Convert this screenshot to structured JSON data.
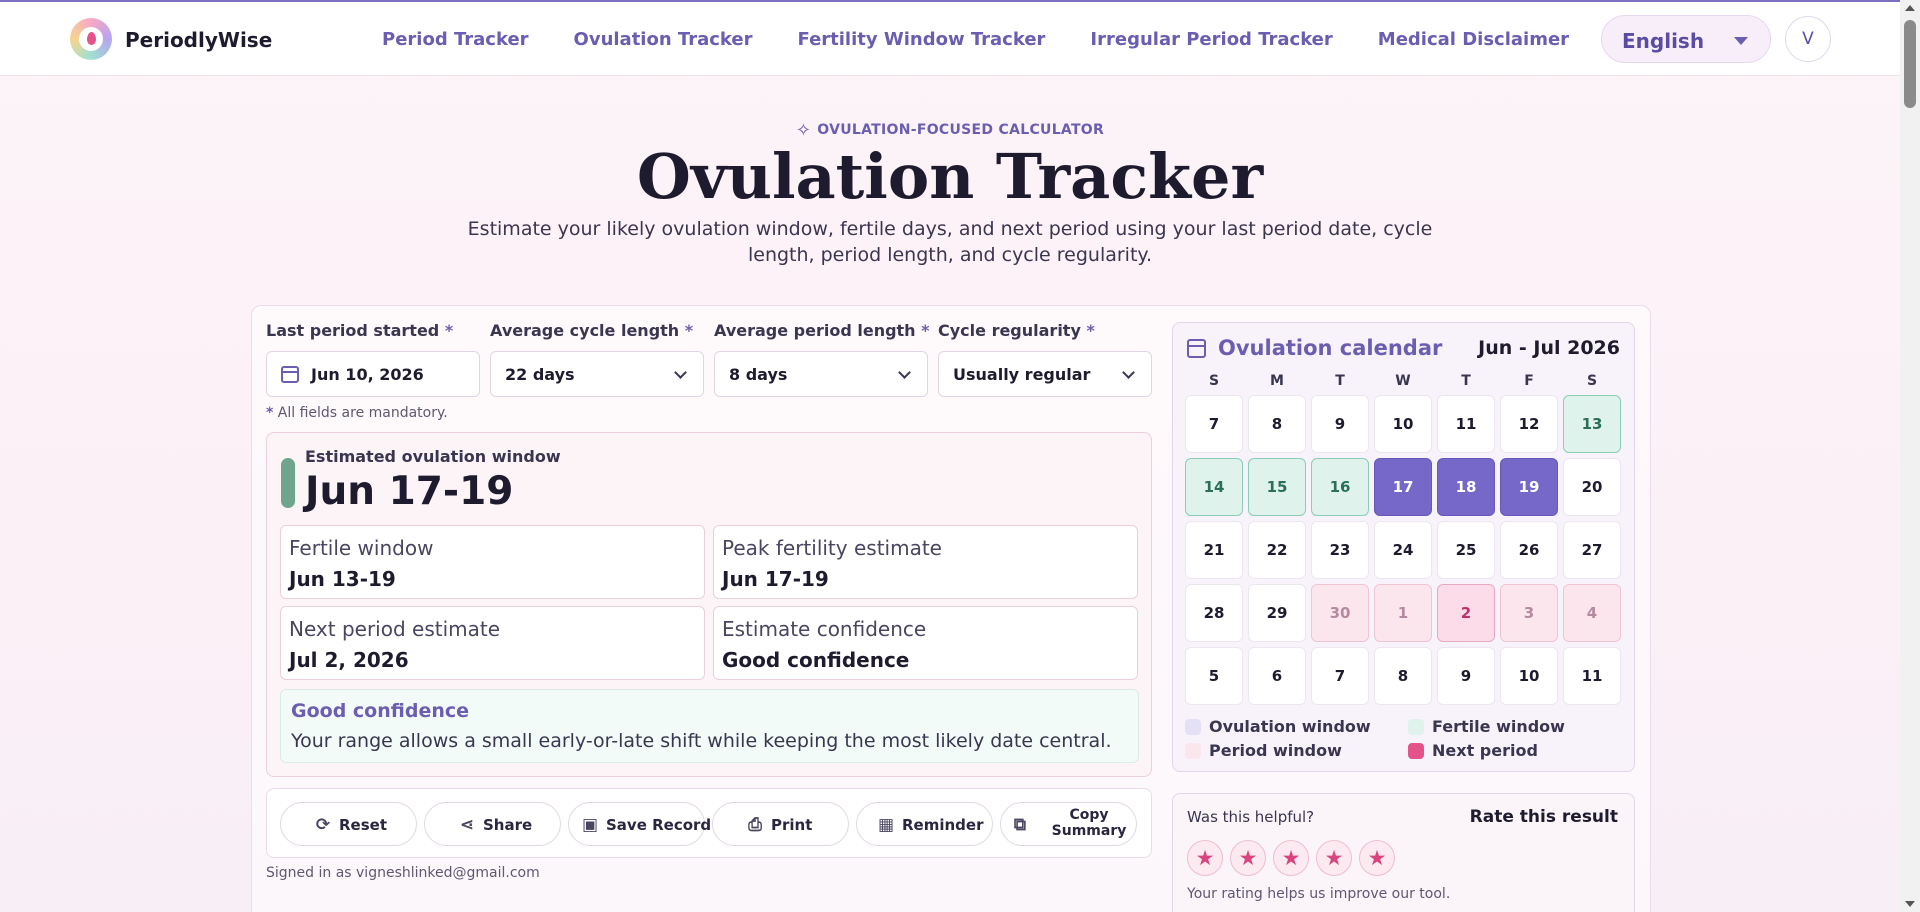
{
  "header": {
    "brand": "PeriodlyWise",
    "nav": [
      "Period Tracker",
      "Ovulation Tracker",
      "Fertility Window Tracker",
      "Irregular Period Tracker",
      "Medical Disclaimer"
    ],
    "language": "English",
    "avatar_initial": "V"
  },
  "hero": {
    "eyebrow": "OVULATION-FOCUSED CALCULATOR",
    "title": "Ovulation Tracker",
    "subtitle": "Estimate your likely ovulation window, fertile days, and next period using your last period date, cycle length, period length, and cycle regularity."
  },
  "form": {
    "last_period": {
      "label": "Last period started",
      "value": "Jun 10, 2026"
    },
    "cycle_length": {
      "label": "Average cycle length",
      "value": "22 days"
    },
    "period_length": {
      "label": "Average period length",
      "value": "8 days"
    },
    "regularity": {
      "label": "Cycle regularity",
      "value": "Usually regular"
    },
    "required_marker": "*",
    "mandatory_note": "All fields are mandatory."
  },
  "result": {
    "est_label": "Estimated ovulation window",
    "est_value": "Jun 17-19",
    "stats": [
      {
        "key": "Fertile window",
        "value": "Jun 13-19"
      },
      {
        "key": "Peak fertility estimate",
        "value": "Jun 17-19"
      },
      {
        "key": "Next period estimate",
        "value": "Jul 2, 2026"
      },
      {
        "key": "Estimate confidence",
        "value": "Good confidence"
      }
    ],
    "confidence_title": "Good confidence",
    "confidence_text": "Your range allows a small early-or-late shift while keeping the most likely date central."
  },
  "actions": [
    "Reset",
    "Share",
    "Save Record",
    "Print",
    "Reminder",
    "Copy Summary"
  ],
  "signed_in": "Signed in as vigneshlinked@gmail.com",
  "calendar": {
    "title": "Ovulation calendar",
    "range": "Jun - Jul 2026",
    "dow": [
      "S",
      "M",
      "T",
      "W",
      "T",
      "F",
      "S"
    ],
    "weeks": [
      [
        {
          "d": "7",
          "t": ""
        },
        {
          "d": "8",
          "t": ""
        },
        {
          "d": "9",
          "t": ""
        },
        {
          "d": "10",
          "t": ""
        },
        {
          "d": "11",
          "t": ""
        },
        {
          "d": "12",
          "t": ""
        },
        {
          "d": "13",
          "t": "fertile"
        }
      ],
      [
        {
          "d": "14",
          "t": "fertile"
        },
        {
          "d": "15",
          "t": "fertile"
        },
        {
          "d": "16",
          "t": "fertile"
        },
        {
          "d": "17",
          "t": "ovu"
        },
        {
          "d": "18",
          "t": "ovu"
        },
        {
          "d": "19",
          "t": "ovu"
        },
        {
          "d": "20",
          "t": ""
        }
      ],
      [
        {
          "d": "21",
          "t": ""
        },
        {
          "d": "22",
          "t": ""
        },
        {
          "d": "23",
          "t": ""
        },
        {
          "d": "24",
          "t": ""
        },
        {
          "d": "25",
          "t": ""
        },
        {
          "d": "26",
          "t": ""
        },
        {
          "d": "27",
          "t": ""
        }
      ],
      [
        {
          "d": "28",
          "t": ""
        },
        {
          "d": "29",
          "t": ""
        },
        {
          "d": "30",
          "t": "period"
        },
        {
          "d": "1",
          "t": "period"
        },
        {
          "d": "2",
          "t": "next"
        },
        {
          "d": "3",
          "t": "period"
        },
        {
          "d": "4",
          "t": "period"
        }
      ],
      [
        {
          "d": "5",
          "t": ""
        },
        {
          "d": "6",
          "t": ""
        },
        {
          "d": "7",
          "t": ""
        },
        {
          "d": "8",
          "t": ""
        },
        {
          "d": "9",
          "t": ""
        },
        {
          "d": "10",
          "t": ""
        },
        {
          "d": "11",
          "t": ""
        }
      ]
    ],
    "legend": [
      {
        "label": "Ovulation window",
        "color": "#e4e0f6"
      },
      {
        "label": "Fertile window",
        "color": "#dff3ec"
      },
      {
        "label": "Period window",
        "color": "#fce6ee"
      },
      {
        "label": "Next period",
        "color": "#e5538b"
      }
    ]
  },
  "rating": {
    "question": "Was this helpful?",
    "title": "Rate this result",
    "stars": 5,
    "note": "Your rating helps us improve our tool."
  },
  "colors": {
    "accent": "#6b5db0",
    "pink": "#e5538b",
    "mint": "#6fa48d"
  }
}
